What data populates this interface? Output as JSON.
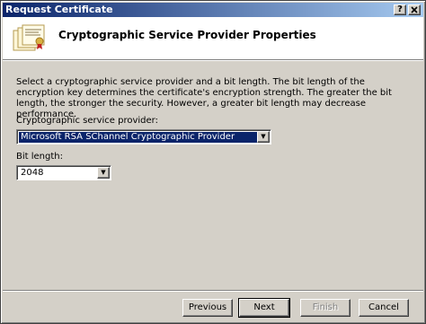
{
  "window": {
    "title": "Request Certificate",
    "help_icon": "?",
    "close_icon": "x"
  },
  "header": {
    "title": "Cryptographic Service Provider Properties"
  },
  "description": "Select a cryptographic service provider and a bit length. The bit length of the encryption key determines the certificate's encryption strength. The greater the bit length, the stronger the security. However, a greater bit length may decrease performance.",
  "csp": {
    "label": "Cryptographic service provider:",
    "value": "Microsoft RSA SChannel Cryptographic Provider"
  },
  "bit_length": {
    "label": "Bit length:",
    "value": "2048"
  },
  "buttons": {
    "previous": "Previous",
    "next": "Next",
    "finish": "Finish",
    "cancel": "Cancel"
  },
  "colors": {
    "titlebar_start": "#0a246a",
    "titlebar_end": "#a6caf0",
    "selection": "#0a246a",
    "face": "#d4d0c8"
  }
}
